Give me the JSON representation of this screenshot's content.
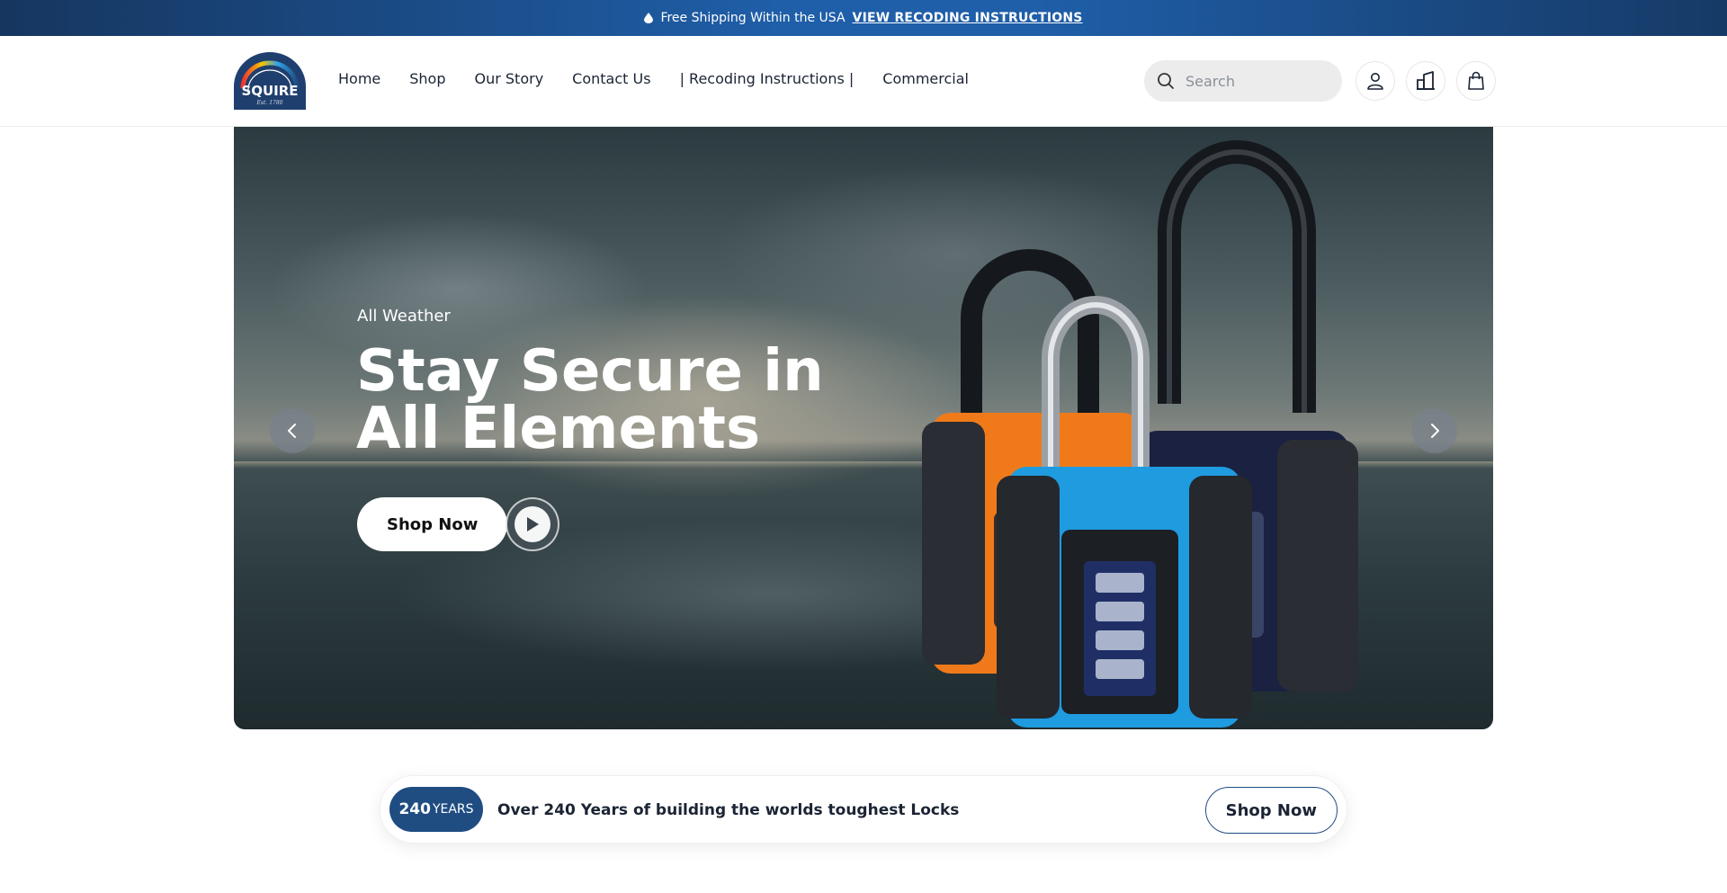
{
  "announcement": {
    "text": "Free Shipping Within the USA",
    "link_label": "VIEW RECODING INSTRUCTIONS",
    "icon": "water-drop-icon"
  },
  "brand": {
    "logo_text": "SQUIRE",
    "logo_tagline": "Est. 1780"
  },
  "nav": {
    "items": [
      {
        "label": "Home"
      },
      {
        "label": "Shop"
      },
      {
        "label": "Our Story"
      },
      {
        "label": "Contact Us"
      },
      {
        "label": "| Recoding Instructions |"
      },
      {
        "label": "Commercial"
      }
    ]
  },
  "search": {
    "placeholder": "Search",
    "value": ""
  },
  "header_icons": [
    "account-icon",
    "store-locator-icon",
    "shopping-bag-icon"
  ],
  "hero": {
    "kicker": "All Weather",
    "title": "Stay Secure in All Elements",
    "cta_label": "Shop Now",
    "prev_icon": "chevron-left-icon",
    "next_icon": "chevron-right-icon",
    "play_icon": "play-icon"
  },
  "promo": {
    "badge_number": "240",
    "badge_word": "YEARS",
    "text": "Over 240 Years of building the worlds toughest Locks",
    "button_label": "Shop Now"
  },
  "colors": {
    "announcement_bg": "#1f5ea8",
    "brand_navy": "#1f4d82",
    "lock_orange": "#f07a1a",
    "lock_blue": "#1f9be0",
    "lock_navy": "#1b2140"
  }
}
